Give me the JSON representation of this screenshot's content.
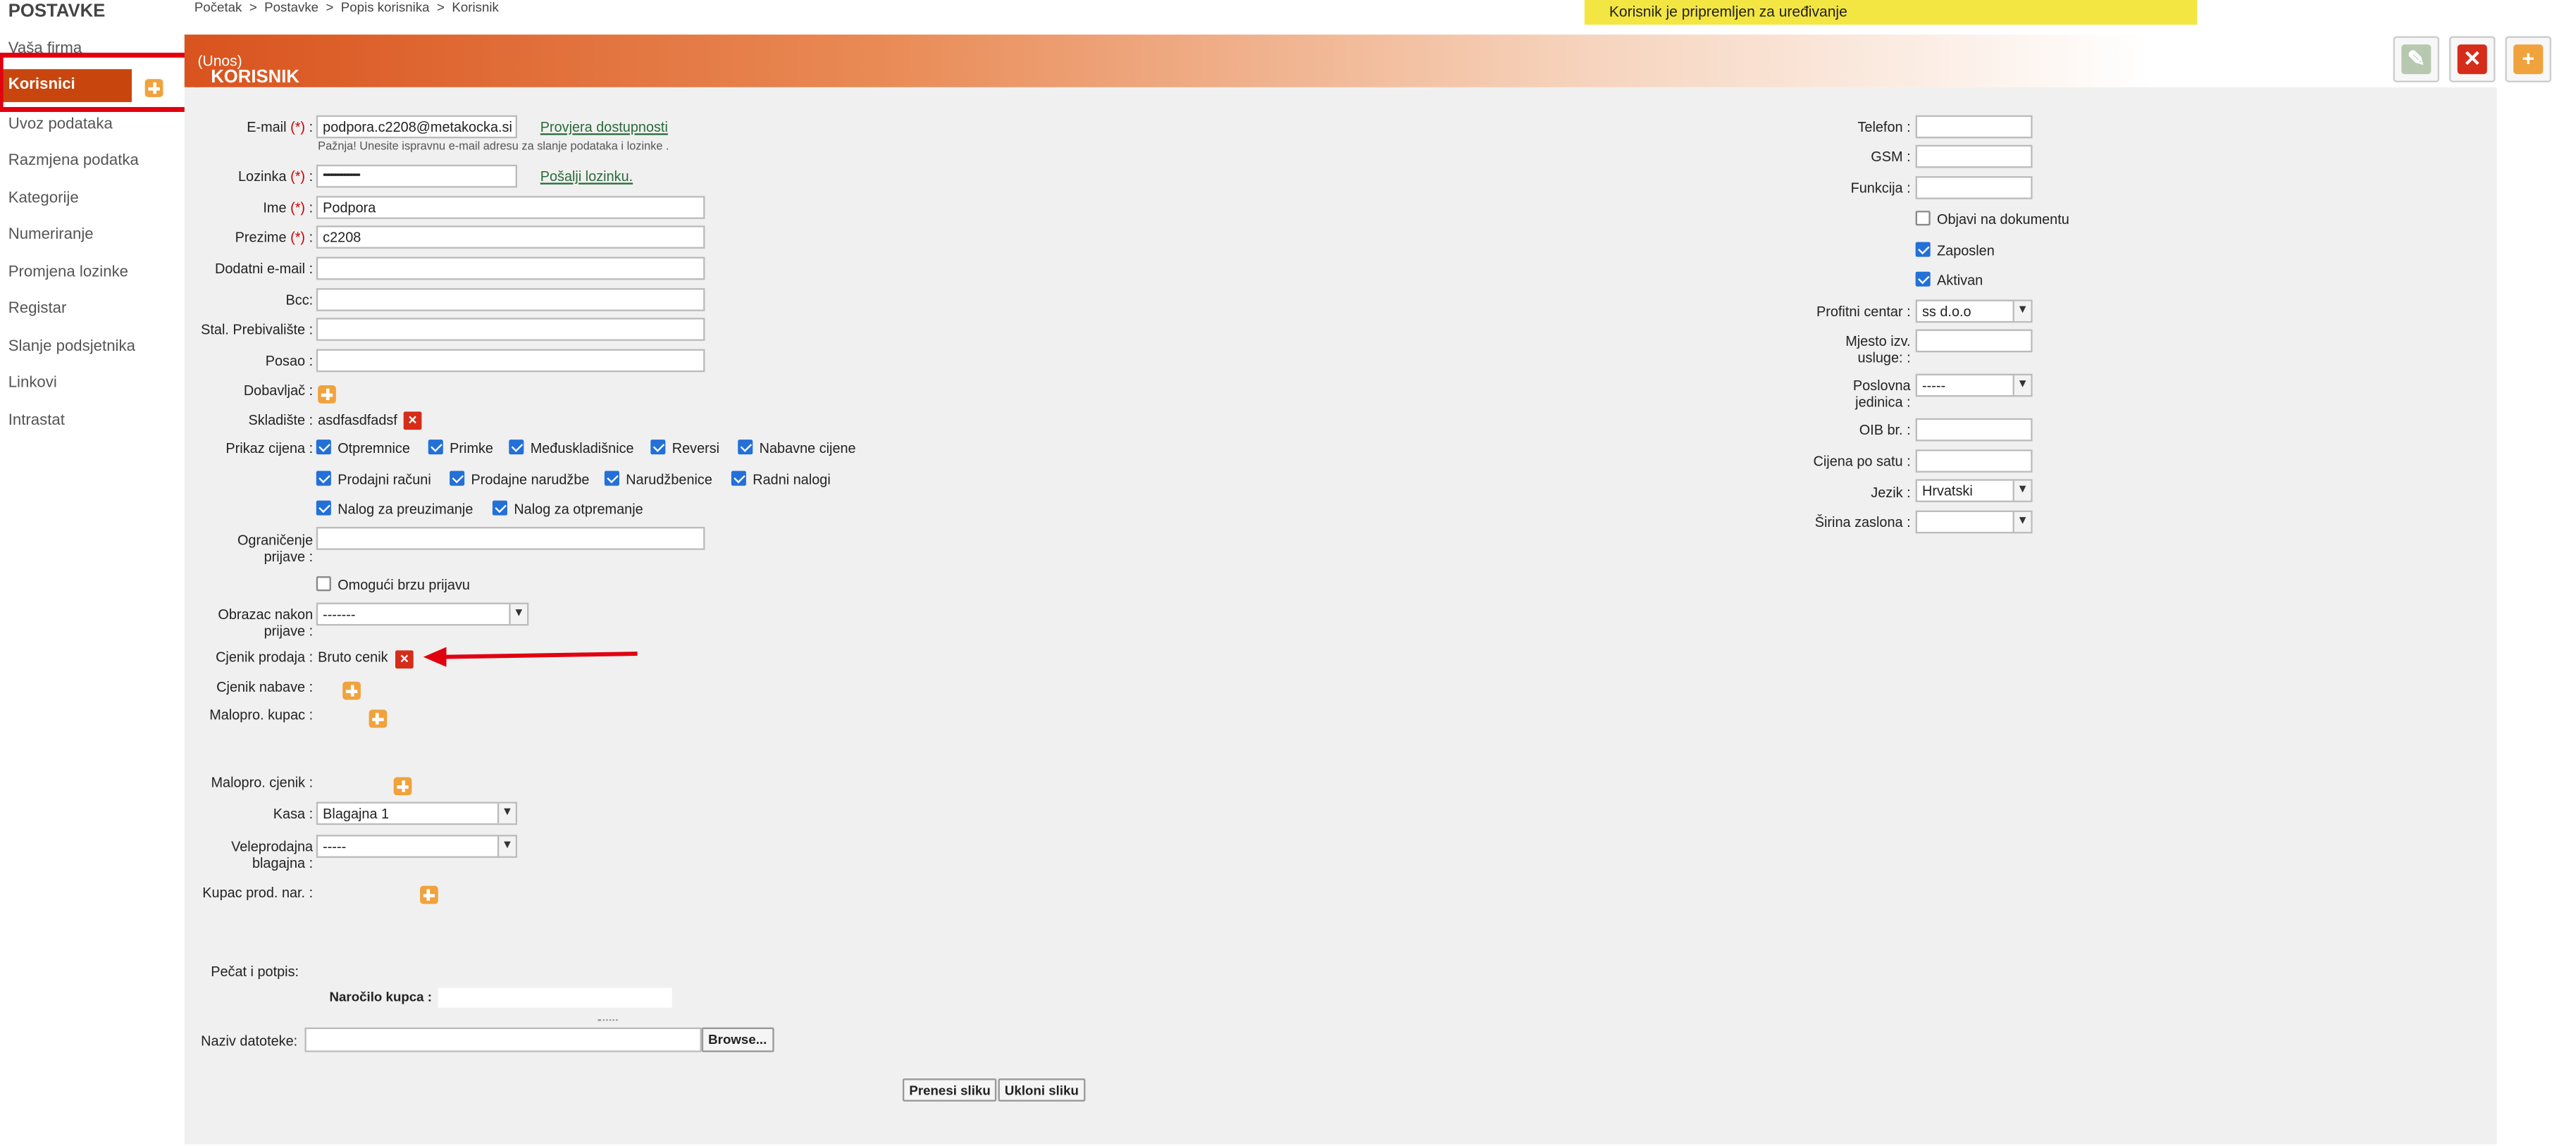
{
  "sidebar": {
    "heading": "POSTAVKE",
    "items": [
      "Vaša firma",
      "Korisnici",
      "Uvoz podataka",
      "Razmjena podatka",
      "Kategorije",
      "Numeriranje",
      "Promjena lozinke",
      "Registar",
      "Slanje podsjetnika",
      "Linkovi",
      "Intrastat"
    ]
  },
  "breadcrumb": [
    "Početak",
    ">",
    "Postavke",
    ">",
    "Popis korisnika",
    ">",
    "Korisnik"
  ],
  "banner": "Korisnik je pripremljen za uređivanje",
  "header": {
    "title": "KORISNIK",
    "mode": "(Unos)"
  },
  "form": {
    "email_label": "E-mail",
    "email_value": "podpora.c2208@metakocka.si",
    "check_link": "Provjera dostupnosti",
    "email_note": "Pažnja! Unesite ispravnu e-mail adresu za slanje podataka i lozinke .",
    "password_label": "Lozinka",
    "password_value": "••••••••••••••••••••",
    "send_link": "Pošalji lozinku.",
    "first_name_label": "Ime",
    "first_name_value": "Podpora",
    "last_name_label": "Prezime",
    "last_name_value": "c2208",
    "extra_email_label": "Dodatni e-mail :",
    "bcc_label": "Bcc:",
    "residence_label": "Stal. Prebivalište :",
    "job_label": "Posao :",
    "supplier_label": "Dobavljač :",
    "warehouse_label": "Skladište :",
    "warehouse_value": "asdfasdfadsf",
    "price_view_label": "Prikaz cijena :",
    "price_options": [
      "Otpremnice",
      "Primke",
      "Međuskladišnice",
      "Reversi",
      "Nabavne cijene",
      "Prodajni računi",
      "Prodajne narudžbe",
      "Narudžbenice",
      "Radni nalogi",
      "Nalog za preuzimanje",
      "Nalog za otpremanje"
    ],
    "login_limit_label": [
      "Ograničenje",
      "prijave :"
    ],
    "quick_login_label": "Omogući brzu prijavu",
    "after_login_label": [
      "Obrazac nakon",
      "prijave :"
    ],
    "after_login_value": "-------",
    "sales_price_label": "Cjenik prodaja :",
    "sales_price_value": "Bruto cenik",
    "purchase_price_label": "Cjenik nabave :",
    "retail_customer_label": "Malopro. kupac :",
    "retail_price_label": "Malopro. cjenik :",
    "cash_label": "Kasa :",
    "cash_value": "Blagajna 1",
    "wholesale_label": [
      "Veleprodajna",
      "blagajna :"
    ],
    "wholesale_value": "-----",
    "customer_order_label": "Kupac prod. nar. :",
    "stamp_label": "Pečat i potpis:",
    "order_label": "Naročilo kupca :",
    "file_label": "Naziv datoteke:",
    "browse_label": "Browse...",
    "upload_label": "Prenesi sliku",
    "remove_label": "Ukloni sliku",
    "right": {
      "phone_label": "Telefon :",
      "gsm_label": "GSM :",
      "function_label": "Funkcija :",
      "publish_label": "Objavi na dokumentu",
      "employed_label": "Zaposlen",
      "active_label": "Aktivan",
      "profit_label": "Profitni centar :",
      "profit_value": "ss d.o.o",
      "place_label": [
        "Mjesto izv.",
        "usluge: :"
      ],
      "unit_label": [
        "Poslovna",
        "jedinica :"
      ],
      "unit_value": "-----",
      "oib_label": "OIB br. :",
      "hourly_label": "Cijena po satu :",
      "lang_label": "Jezik :",
      "lang_value": "Hrvatski",
      "width_label": "Širina zaslona :"
    }
  },
  "colors": {
    "accent": "#c8460e",
    "banner": "#f4e642",
    "highlight": "#e00010"
  }
}
